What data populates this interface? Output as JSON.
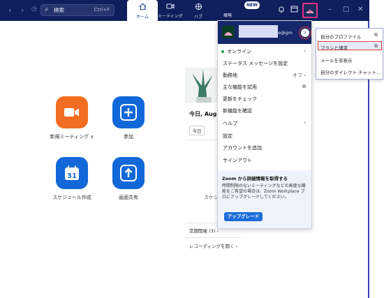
{
  "titlebar": {
    "back_icon": "chevron-left-icon",
    "forward_icon": "chevron-right-icon",
    "search_label": "検索",
    "search_shortcut": "Ctrl+F",
    "tabs": [
      {
        "label": "ホーム",
        "icon": "home-icon"
      },
      {
        "label": "ミーティング",
        "icon": "video-icon"
      },
      {
        "label": "ハブ",
        "icon": "hub-icon"
      },
      {
        "label": "概略",
        "icon": "overview-icon"
      }
    ],
    "new_badge": "NEW",
    "colors": {
      "bar": "#0f1f5c",
      "active_tab": "#ffffff",
      "avatar_highlight": "#e2338a"
    }
  },
  "home": {
    "tiles": [
      {
        "label": "新規ミーティング",
        "suffix": "∨",
        "color": "#f26d21",
        "icon": "video-camera-icon"
      },
      {
        "label": "参加",
        "color": "#1268d8",
        "icon": "plus-icon"
      },
      {
        "label": "スケジュール作成",
        "color": "#1268d8",
        "icon": "calendar-icon",
        "calendar_day": "31"
      },
      {
        "label": "画面共有",
        "color": "#1268d8",
        "icon": "share-up-icon"
      }
    ]
  },
  "calendar_panel": {
    "date_title": "今日, Aug",
    "today_button": "今日",
    "schedule_text": "スケジ",
    "regular_meetings": "定期開催 (3)",
    "recording_link": "レコーディングを開く"
  },
  "profile_menu": {
    "email_tail": "e@gm",
    "items": [
      {
        "label": "オンライン",
        "right": "›"
      },
      {
        "label": "ステータス メッセージを設定",
        "right": ""
      },
      {
        "label": "勤務地",
        "right": "オフ ›"
      },
      {
        "label": "主な機能を試用",
        "right": "⧉"
      },
      {
        "label": "更新をチェック",
        "right": ""
      },
      {
        "label": "新機能を確認",
        "right": ""
      },
      {
        "label": "ヘルプ",
        "right": "›"
      },
      {
        "label": "設定",
        "right": ""
      },
      {
        "label": "アカウントを追加",
        "right": ""
      },
      {
        "label": "サインアウト",
        "right": ""
      }
    ],
    "promo": {
      "title": "Zoom から詳細情報を取得する",
      "body": "時間制限のないミーティングなどの高度な機能をご希望の場合は、Zoom Workplace プロにアップグレードしてください。",
      "button": "アップグレード"
    }
  },
  "profile_submenu": {
    "items": [
      {
        "label": "自分のプロファイル",
        "external": true
      },
      {
        "label": "プランと請求",
        "external": true
      },
      {
        "label": "メールを非表示",
        "external": false
      },
      {
        "label": "自分のダイレクト チャット...",
        "external": false
      }
    ]
  }
}
